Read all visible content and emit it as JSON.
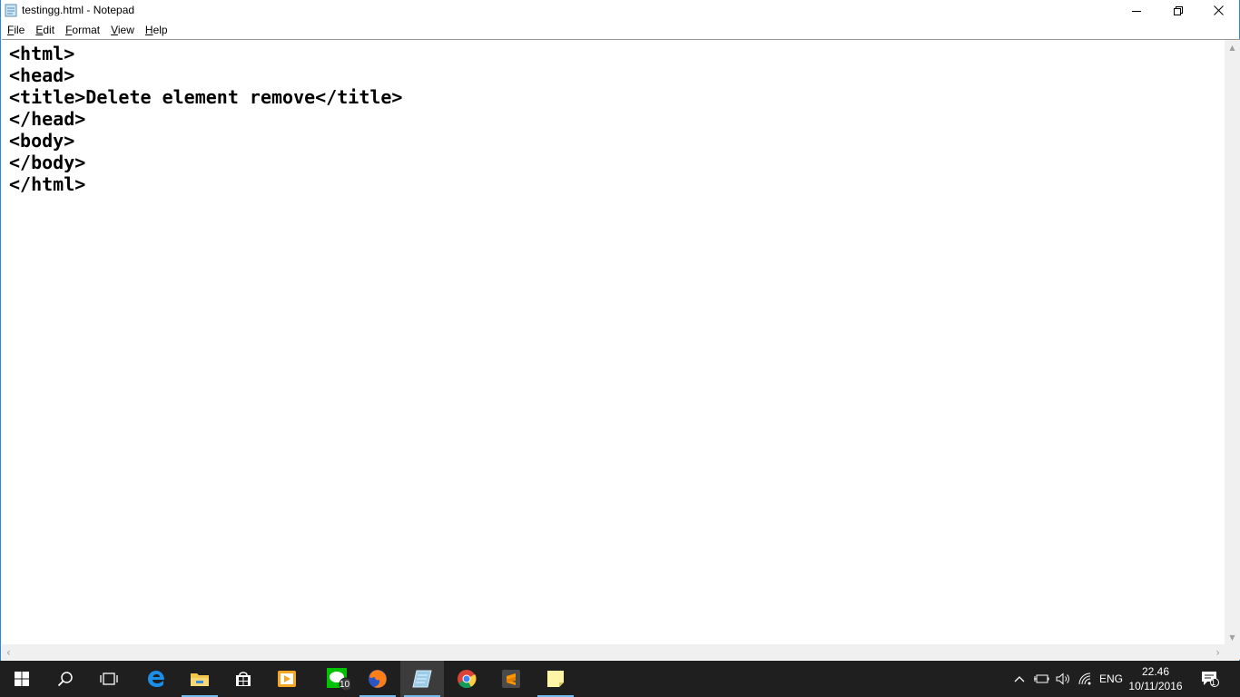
{
  "window": {
    "title": "testingg.html - Notepad"
  },
  "menubar": {
    "items": [
      {
        "label": "File",
        "underline": "F",
        "rest": "ile"
      },
      {
        "label": "Edit",
        "underline": "E",
        "rest": "dit"
      },
      {
        "label": "Format",
        "underline": "F",
        "rest": "ormat"
      },
      {
        "label": "View",
        "underline": "V",
        "rest": "iew"
      },
      {
        "label": "Help",
        "underline": "H",
        "rest": "elp"
      }
    ]
  },
  "editor": {
    "content": "<html>\n<head>\n<title>Delete element remove</title>\n</head>\n<body>\n</body>\n</html>"
  },
  "taskbar": {
    "apps": [
      {
        "name": "start-button"
      },
      {
        "name": "search-button"
      },
      {
        "name": "task-view-button"
      },
      {
        "name": "edge-icon"
      },
      {
        "name": "file-explorer-icon",
        "running": true
      },
      {
        "name": "store-icon"
      },
      {
        "name": "media-player-icon"
      },
      {
        "name": "line-icon",
        "badge": "10"
      },
      {
        "name": "firefox-icon",
        "running": true
      },
      {
        "name": "notepad-icon",
        "running": true,
        "active": true
      },
      {
        "name": "chrome-icon"
      },
      {
        "name": "sublime-icon"
      },
      {
        "name": "sticky-notes-icon",
        "running": true
      }
    ],
    "tray": {
      "language": "ENG",
      "time": "22.46",
      "date": "10/11/2016",
      "notifications": "1"
    }
  },
  "colors": {
    "accent": "#2b88d8",
    "taskbar": "#1f1f1f",
    "running_indicator": "#76b9ed"
  }
}
